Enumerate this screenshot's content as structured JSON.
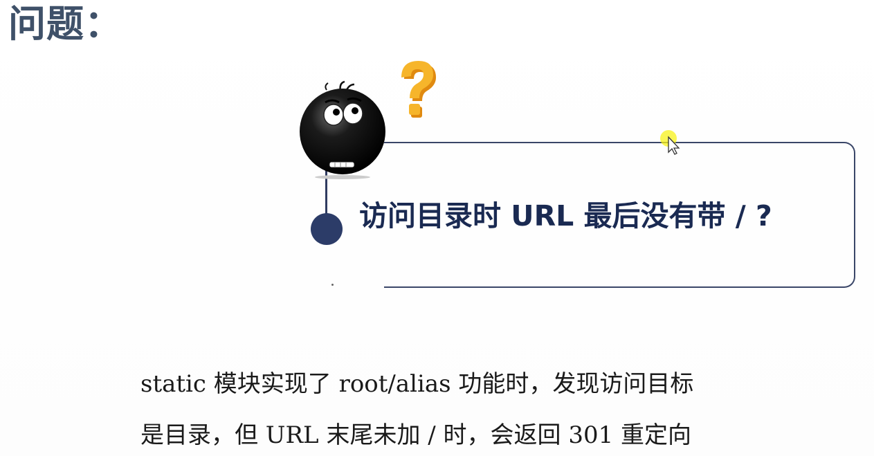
{
  "slide": {
    "title": "问题：",
    "question": "访问目录时 URL 最后没有带 / ?",
    "body_lines": [
      "static 模块实现了 root/alias 功能时，发现访问目标",
      "是目录，但 URL 末尾未加 / 时，会返回 301 重定向"
    ]
  },
  "decorations": {
    "character_icon": "confused-bomb-face-icon",
    "question_mark_icon": "question-mark-icon",
    "cursor_icon": "mouse-pointer-icon"
  },
  "colors": {
    "title": "#3f5169",
    "accent_navy": "#2c3c68",
    "question_mark": "#f2a81d"
  }
}
